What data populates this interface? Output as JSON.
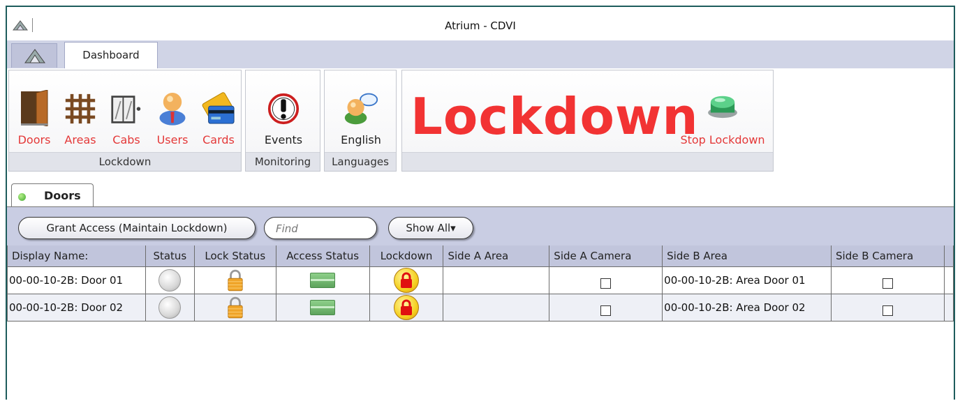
{
  "window": {
    "title": "Atrium - CDVI"
  },
  "ribbon_tabs": {
    "home_icon": "app-logo-icon",
    "dashboard": "Dashboard"
  },
  "groups": {
    "lockdown": {
      "label": "Lockdown",
      "buttons": [
        {
          "label": "Doors",
          "icon": "door-icon"
        },
        {
          "label": "Areas",
          "icon": "areas-grid-icon"
        },
        {
          "label": "Cabs",
          "icon": "elevator-cab-icon"
        },
        {
          "label": "Users",
          "icon": "user-icon"
        },
        {
          "label": "Cards",
          "icon": "card-icon"
        }
      ]
    },
    "monitoring": {
      "label": "Monitoring",
      "buttons": [
        {
          "label": "Events",
          "icon": "alert-icon"
        }
      ]
    },
    "languages": {
      "label": "Languages",
      "buttons": [
        {
          "label": "English",
          "icon": "language-user-icon"
        }
      ]
    },
    "big": {
      "lockdown_text": "Lockdown",
      "stop_label": "Stop Lockdown"
    }
  },
  "doc_tab": {
    "label": "Doors"
  },
  "toolbar": {
    "grant_access": "Grant Access (Maintain Lockdown)",
    "find_placeholder": "Find",
    "show_all": "Show All▾"
  },
  "table": {
    "columns": [
      "Display Name:",
      "Status",
      "Lock Status",
      "Access Status",
      "Lockdown",
      "Side A Area",
      "Side A Camera",
      "Side B Area",
      "Side B Camera"
    ],
    "rows": [
      {
        "display_name": "00-00-10-2B: Door 01",
        "side_a_area": "",
        "side_b_area": "00-00-10-2B: Area Door 01"
      },
      {
        "display_name": "00-00-10-2B: Door 02",
        "side_a_area": "",
        "side_b_area": "00-00-10-2B: Area Door 02"
      }
    ]
  },
  "colors": {
    "accent_red": "#f23333",
    "ribbon_tab_bg": "#d0d4e6",
    "toolbar_bg": "#c9cde3",
    "header_bg": "#c1c5dc"
  }
}
